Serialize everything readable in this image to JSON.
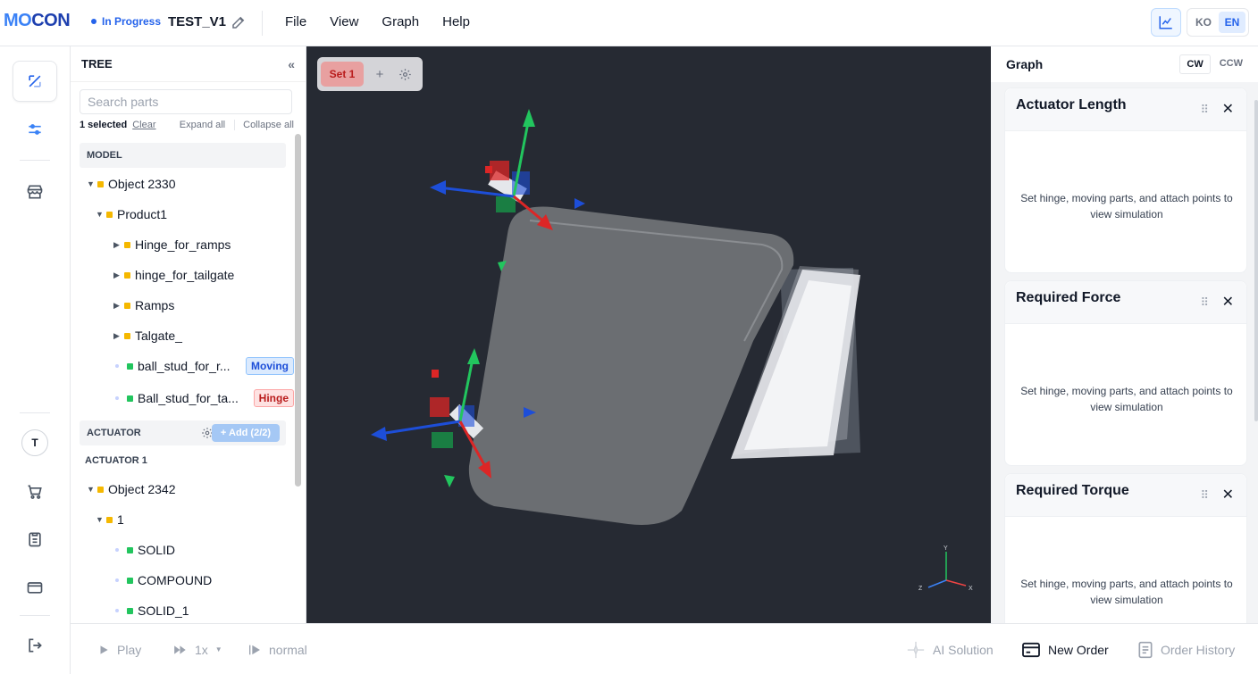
{
  "header": {
    "logo": {
      "part1": "MO",
      "part2": "CON"
    },
    "status": "In Progress",
    "project_name": "TEST_V1",
    "menu": [
      "File",
      "View",
      "Graph",
      "Help"
    ],
    "lang": [
      "KO",
      "EN"
    ],
    "lang_active": "EN"
  },
  "rail": {
    "avatar_initial": "T"
  },
  "tree": {
    "title": "TREE",
    "collapse_glyph": "«",
    "search_placeholder": "Search parts",
    "selected_count": "1 selected",
    "clear": "Clear",
    "expand_all": "Expand all",
    "collapse_all": "Collapse all",
    "model_header": "MODEL",
    "model_items": [
      {
        "label": "Object 2330"
      },
      {
        "label": "Product1"
      },
      {
        "label": "Hinge_for_ramps"
      },
      {
        "label": "hinge_for_tailgate"
      },
      {
        "label": "Ramps"
      },
      {
        "label": "Talgate_"
      },
      {
        "label": "ball_stud_for_r...",
        "badge": "Moving"
      },
      {
        "label": "Ball_stud_for_ta...",
        "badge": "Hinge"
      }
    ],
    "actuator_header": "ACTUATOR",
    "add_button": "+ Add (2/2)",
    "actuator_sub": "ACTUATOR 1",
    "actuator_items": [
      {
        "label": "Object 2342"
      },
      {
        "label": "1"
      },
      {
        "label": "SOLID"
      },
      {
        "label": "COMPOUND"
      },
      {
        "label": "SOLID_1"
      }
    ]
  },
  "viewport": {
    "set_tab": "Set 1",
    "add_set": "+",
    "axis_labels": {
      "x": "X",
      "y": "Y",
      "z": "Z"
    }
  },
  "graph": {
    "title": "Graph",
    "directions": [
      "CW",
      "CCW"
    ],
    "direction_active": "CW",
    "cards": [
      {
        "title": "Actuator Length",
        "message": "Set hinge, moving parts, and attach points to view simulation"
      },
      {
        "title": "Required Force",
        "message": "Set hinge, moving parts, and attach points to view simulation"
      },
      {
        "title": "Required Torque",
        "message": "Set hinge, moving parts, and attach points to view simulation"
      }
    ]
  },
  "bottom": {
    "play": "Play",
    "speed": "1x",
    "mode": "normal",
    "ai_solution": "AI Solution",
    "new_order": "New Order",
    "order_history": "Order History"
  },
  "colors": {
    "accent": "#2563eb",
    "viewport_bg": "#262a33",
    "moving_badge": "#1d4ed8",
    "hinge_badge": "#b91c1c",
    "tree_part_icon": "#f5b800",
    "tree_solid_icon": "#22c55e"
  }
}
